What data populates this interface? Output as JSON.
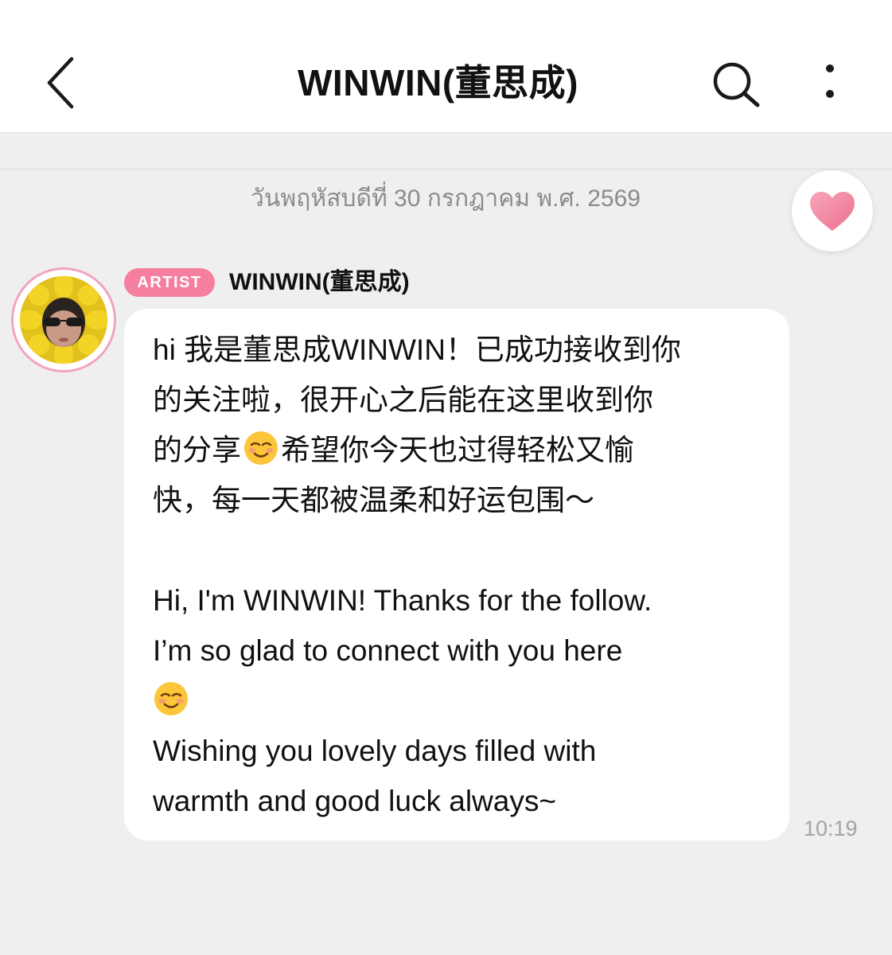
{
  "header": {
    "title": "WINWIN(董思成)",
    "back_icon": "chevron-left-icon",
    "search_icon": "search-icon",
    "more_icon": "more-vertical-icon"
  },
  "chat": {
    "date_label": "วันพฤหัสบดีที่ 30 กรกฎาคม พ.ศ. 2569",
    "like_icon": "heart-icon",
    "like_color": "#f2879f",
    "accent_color": "#f67f9f",
    "message": {
      "badge": "ARTIST",
      "sender": "WINWIN(董思成)",
      "avatar_icon": "sunflower-avatar",
      "emoji_icon": "smiling-relieved-emoji",
      "lines": {
        "l1": "hi 我是董思成WINWIN！已成功接收到你",
        "l2": "的关注啦，很开心之后能在这里收到你",
        "l3a": "的分享",
        "l3b": "希望你今天也过得轻松又愉",
        "l4": "快，每一天都被温柔和好运包围～",
        "l5": "Hi, I'm WINWIN! Thanks for the follow.",
        "l6": "I’m so glad to connect with you here",
        "l8": "Wishing you lovely days filled with",
        "l9": "warmth and good luck always~"
      },
      "time": "10:19"
    }
  }
}
